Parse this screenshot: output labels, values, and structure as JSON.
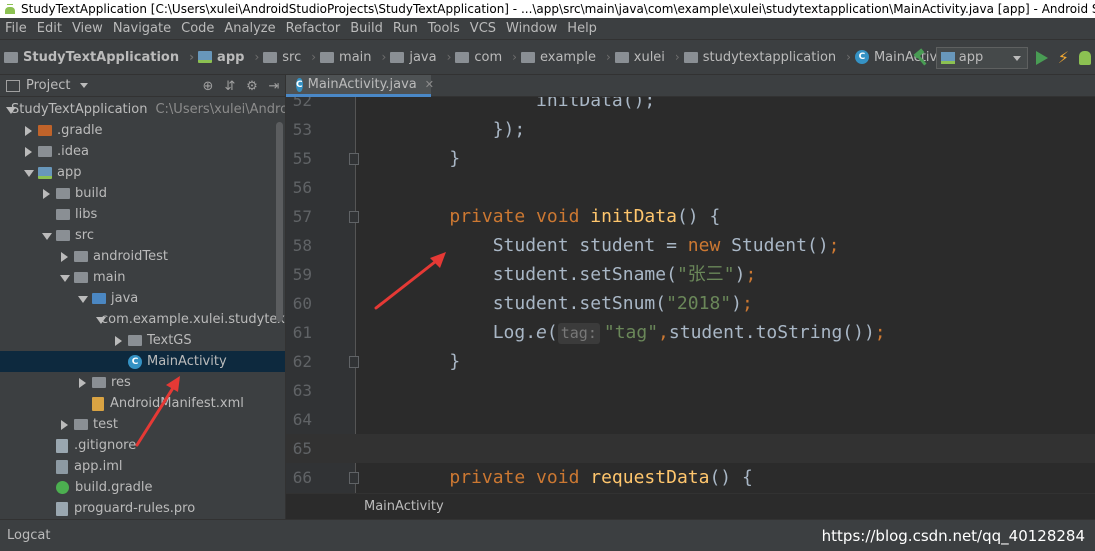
{
  "window": {
    "title": "StudyTextApplication [C:\\Users\\xulei\\AndroidStudioProjects\\StudyTextApplication] - ...\\app\\src\\main\\java\\com\\example\\xulei\\studytextapplication\\MainActivity.java [app] - Android Studio"
  },
  "menu": [
    "File",
    "Edit",
    "View",
    "Navigate",
    "Code",
    "Analyze",
    "Refactor",
    "Build",
    "Run",
    "Tools",
    "VCS",
    "Window",
    "Help"
  ],
  "navbar": {
    "crumbs": [
      {
        "label": "StudyTextApplication",
        "icon": "folder-icon"
      },
      {
        "label": "app",
        "icon": "module-icon"
      },
      {
        "label": "src",
        "icon": "folder-icon"
      },
      {
        "label": "main",
        "icon": "folder-icon"
      },
      {
        "label": "java",
        "icon": "folder-icon"
      },
      {
        "label": "com",
        "icon": "folder-icon"
      },
      {
        "label": "example",
        "icon": "folder-icon"
      },
      {
        "label": "xulei",
        "icon": "folder-icon"
      },
      {
        "label": "studytextapplication",
        "icon": "folder-icon"
      },
      {
        "label": "MainActivity",
        "icon": "class-icon"
      }
    ],
    "run_config": "app"
  },
  "project": {
    "header": "Project",
    "tree": [
      {
        "label": "StudyTextApplication",
        "path": "C:\\Users\\xulei\\Andro",
        "depth": 0,
        "arrow": "down",
        "icon": "module"
      },
      {
        "label": ".gradle",
        "depth": 1,
        "arrow": "right",
        "icon": "folder-orange"
      },
      {
        "label": ".idea",
        "depth": 1,
        "arrow": "right",
        "icon": "folder"
      },
      {
        "label": "app",
        "depth": 1,
        "arrow": "down",
        "icon": "module"
      },
      {
        "label": "build",
        "depth": 2,
        "arrow": "right",
        "icon": "folder"
      },
      {
        "label": "libs",
        "depth": 2,
        "arrow": "none",
        "icon": "folder"
      },
      {
        "label": "src",
        "depth": 2,
        "arrow": "down",
        "icon": "folder"
      },
      {
        "label": "androidTest",
        "depth": 3,
        "arrow": "right",
        "icon": "folder"
      },
      {
        "label": "main",
        "depth": 3,
        "arrow": "down",
        "icon": "folder"
      },
      {
        "label": "java",
        "depth": 4,
        "arrow": "down",
        "icon": "folder-blue"
      },
      {
        "label": "com.example.xulei.studytextapplication",
        "depth": 5,
        "arrow": "down",
        "icon": "folder"
      },
      {
        "label": "TextGS",
        "depth": 6,
        "arrow": "right",
        "icon": "folder"
      },
      {
        "label": "MainActivity",
        "depth": 6,
        "arrow": "none",
        "icon": "class",
        "selected": true
      },
      {
        "label": "res",
        "depth": 4,
        "arrow": "right",
        "icon": "folder"
      },
      {
        "label": "AndroidManifest.xml",
        "depth": 4,
        "arrow": "none",
        "icon": "xml"
      },
      {
        "label": "test",
        "depth": 3,
        "arrow": "right",
        "icon": "folder"
      },
      {
        "label": ".gitignore",
        "depth": 2,
        "arrow": "none",
        "icon": "file"
      },
      {
        "label": "app.iml",
        "depth": 2,
        "arrow": "none",
        "icon": "iml"
      },
      {
        "label": "build.gradle",
        "depth": 2,
        "arrow": "none",
        "icon": "gradle"
      },
      {
        "label": "proguard-rules.pro",
        "depth": 2,
        "arrow": "none",
        "icon": "file"
      }
    ]
  },
  "editor": {
    "tab": "MainActivity.java",
    "footer": "MainActivity",
    "lines": [
      {
        "num": "52",
        "segments": [
          {
            "t": "            initData();",
            "c": "plain"
          }
        ]
      },
      {
        "num": "53",
        "segments": [
          {
            "t": "        });",
            "c": "plain"
          }
        ]
      },
      {
        "num": "55",
        "fold": true,
        "segments": [
          {
            "t": "    }",
            "c": "plain"
          }
        ]
      },
      {
        "num": "56",
        "segments": []
      },
      {
        "num": "57",
        "fold": true,
        "segments": [
          {
            "t": "    ",
            "c": "plain"
          },
          {
            "t": "private void ",
            "c": "kw"
          },
          {
            "t": "initData",
            "c": "fn"
          },
          {
            "t": "() {",
            "c": "plain"
          }
        ]
      },
      {
        "num": "58",
        "segments": [
          {
            "t": "        Student student = ",
            "c": "plain"
          },
          {
            "t": "new ",
            "c": "kw"
          },
          {
            "t": "Student()",
            "c": "plain"
          },
          {
            "t": ";",
            "c": "kw"
          }
        ]
      },
      {
        "num": "59",
        "segments": [
          {
            "t": "        student.setSname(",
            "c": "plain"
          },
          {
            "t": "\"张三\"",
            "c": "str"
          },
          {
            "t": ")",
            "c": "plain"
          },
          {
            "t": ";",
            "c": "kw"
          }
        ]
      },
      {
        "num": "60",
        "segments": [
          {
            "t": "        student.setSnum(",
            "c": "plain"
          },
          {
            "t": "\"2018\"",
            "c": "str"
          },
          {
            "t": ")",
            "c": "plain"
          },
          {
            "t": ";",
            "c": "kw"
          }
        ]
      },
      {
        "num": "61",
        "segments": [
          {
            "t": "        Log.",
            "c": "plain"
          },
          {
            "t": "e",
            "c": "it"
          },
          {
            "t": "(",
            "c": "plain"
          },
          {
            "t": "tag:",
            "c": "hint"
          },
          {
            "t": "\"tag\"",
            "c": "str"
          },
          {
            "t": ",",
            "c": "kw"
          },
          {
            "t": "student.toString())",
            "c": "plain"
          },
          {
            "t": ";",
            "c": "kw"
          }
        ]
      },
      {
        "num": "62",
        "fold": true,
        "segments": [
          {
            "t": "    }",
            "c": "plain"
          }
        ]
      },
      {
        "num": "63",
        "segments": []
      },
      {
        "num": "64",
        "segments": []
      },
      {
        "num": "65",
        "current": true,
        "segments": []
      },
      {
        "num": "66",
        "fold": true,
        "segments": [
          {
            "t": "    ",
            "c": "plain"
          },
          {
            "t": "private void ",
            "c": "kw"
          },
          {
            "t": "requestData",
            "c": "fn"
          },
          {
            "t": "() {",
            "c": "plain"
          }
        ]
      }
    ]
  },
  "statusbar": {
    "left": "Logcat",
    "watermark": "https://blog.csdn.net/qq_40128284"
  },
  "colors": {
    "accent": "#4a88c7",
    "annotation": "#e53935",
    "selection": "#0d293e"
  }
}
